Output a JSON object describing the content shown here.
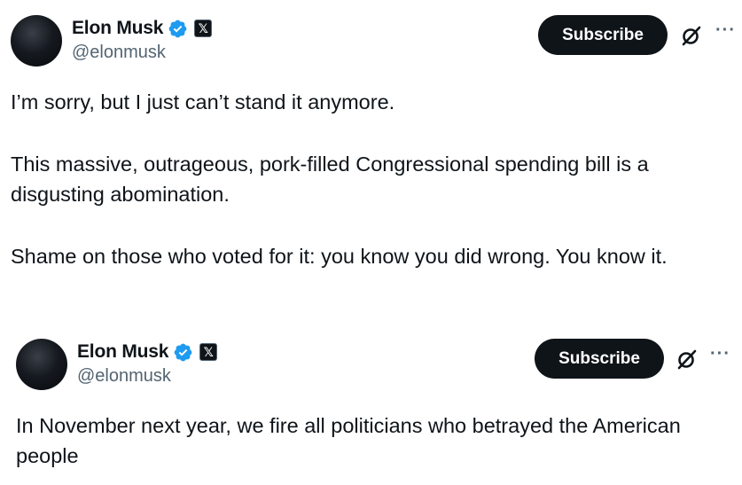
{
  "tweets": [
    {
      "author": {
        "name": "Elon Musk",
        "handle": "@elonmusk",
        "verified_icon": "verified-badge-blue",
        "affiliate_badge": "𝕏"
      },
      "subscribe_label": "Subscribe",
      "more_label": "···",
      "paragraphs": [
        "I’m sorry, but I just can’t stand it anymore.",
        "This massive, outrageous, pork-filled Congressional spending bill is a disgusting abomination.",
        "Shame on those who voted for it: you know you did wrong. You know it."
      ]
    },
    {
      "author": {
        "name": "Elon Musk",
        "handle": "@elonmusk",
        "verified_icon": "verified-badge-blue",
        "affiliate_badge": "𝕏"
      },
      "subscribe_label": "Subscribe",
      "more_label": "···",
      "paragraphs": [
        "In November next year, we fire all politicians who betrayed the American people"
      ]
    }
  ],
  "colors": {
    "verified": "#1d9bf0",
    "text": "#0f1419",
    "secondary": "#536471",
    "button_bg": "#0f1419"
  }
}
